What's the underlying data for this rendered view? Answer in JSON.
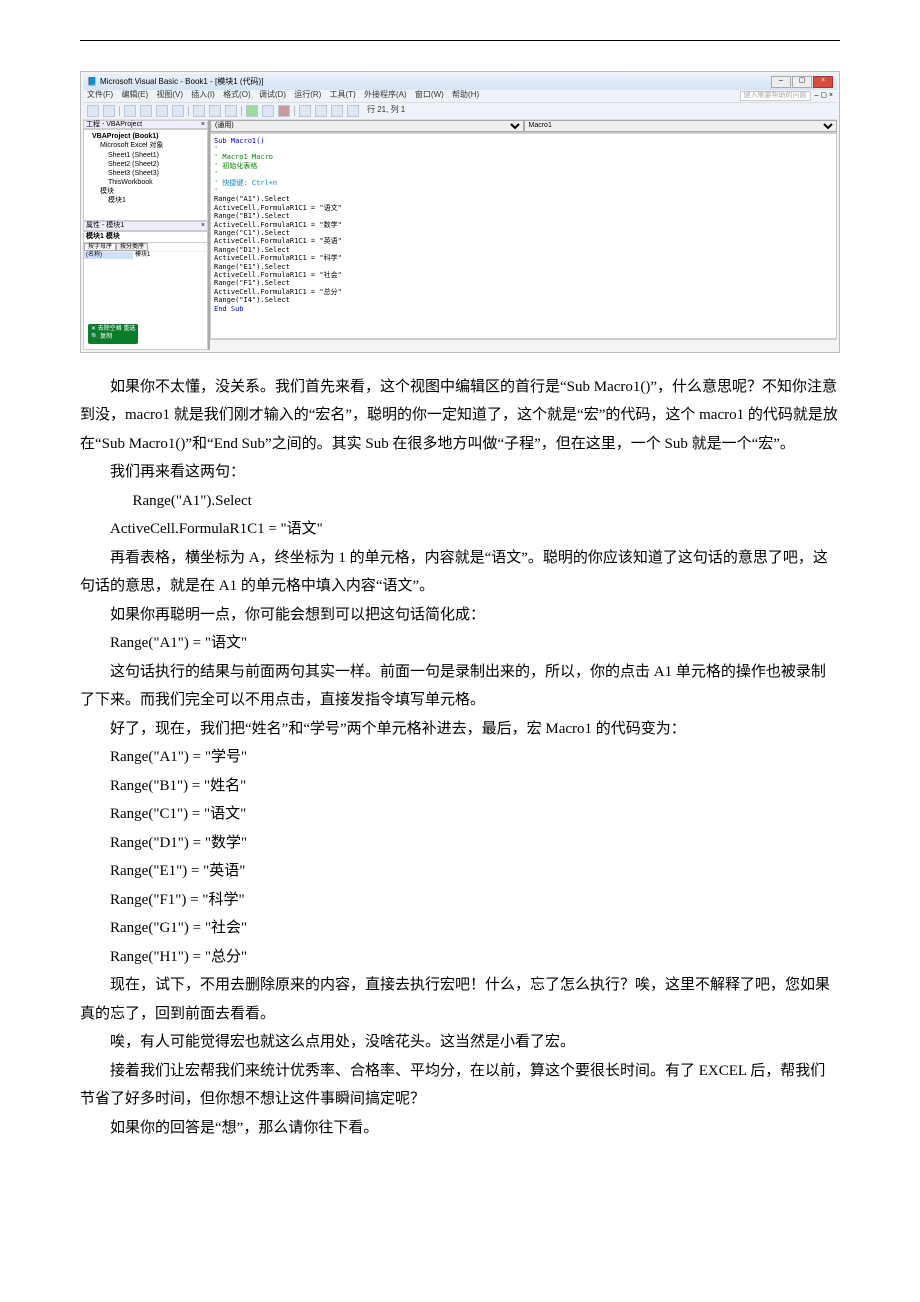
{
  "screenshot": {
    "title": "Microsoft Visual Basic - Book1 - [模块1 (代码)]",
    "helpPlaceholder": "键入需要帮助的问题",
    "menu": [
      "文件(F)",
      "编辑(E)",
      "视图(V)",
      "插入(I)",
      "格式(O)",
      "调试(D)",
      "运行(R)",
      "工具(T)",
      "外接程序(A)",
      "窗口(W)",
      "帮助(H)"
    ],
    "toolbarStatus": "行 21, 列 1",
    "projectPaneTitle": "工程 - VBAProject",
    "tree": {
      "root": "VBAProject (Book1)",
      "folder1": "Microsoft Excel 对象",
      "sheets": [
        "Sheet1 (Sheet1)",
        "Sheet2 (Sheet2)",
        "Sheet3 (Sheet3)",
        "ThisWorkbook"
      ],
      "folder2": "模块",
      "module": "模块1"
    },
    "propPaneTitle": "属性 - 模块1",
    "propSelect": "模块1 模块",
    "tabs": [
      "按字母序",
      "按分类序"
    ],
    "propRow": {
      "k": "(名称)",
      "v": "模块1"
    },
    "tooltip1": "去除空格 重选",
    "tooltip2": "复制",
    "dropdown1": "(通用)",
    "dropdown2": "Macro1",
    "code": {
      "l1": "Sub Macro1()",
      "l2": "'",
      "l3": "' Macro1 Macro",
      "l4": "' 初始化表格",
      "l5": "'",
      "l6": "' 快捷键: Ctrl+n",
      "l7": "'",
      "c1a": "    Range(\"A1\").Select",
      "c1b": "    ActiveCell.FormulaR1C1 = \"语文\"",
      "c2a": "    Range(\"B1\").Select",
      "c2b": "    ActiveCell.FormulaR1C1 = \"数学\"",
      "c3a": "    Range(\"C1\").Select",
      "c3b": "    ActiveCell.FormulaR1C1 = \"英语\"",
      "c4a": "    Range(\"D1\").Select",
      "c4b": "    ActiveCell.FormulaR1C1 = \"科学\"",
      "c5a": "    Range(\"E1\").Select",
      "c5b": "    ActiveCell.FormulaR1C1 = \"社会\"",
      "c6a": "    Range(\"F1\").Select",
      "c6b": "    ActiveCell.FormulaR1C1 = \"总分\"",
      "c7": "    Range(\"I4\").Select",
      "end": "End Sub"
    }
  },
  "body": {
    "p1": "如果你不太懂，没关系。我们首先来看，这个视图中编辑区的首行是“Sub Macro1()”，什么意思呢？不知你注意到没，macro1 就是我们刚才输入的“宏名”，聪明的你一定知道了，这个就是“宏”的代码，这个 macro1 的代码就是放在“Sub Macro1()”和“End Sub”之间的。其实 Sub 在很多地方叫做“子程”，但在这里，一个 Sub 就是一个“宏”。",
    "p2": "我们再来看这两句：",
    "c1": "Range(\"A1\").Select",
    "c2": "ActiveCell.FormulaR1C1 = \"语文\"",
    "p3": "再看表格，横坐标为 A，终坐标为 1 的单元格，内容就是“语文”。聪明的你应该知道了这句话的意思了吧，这句话的意思，就是在 A1 的单元格中填入内容“语文”。",
    "p4": "如果你再聪明一点，你可能会想到可以把这句话简化成：",
    "c3": "Range(\"A1\") = \"语文\"",
    "p5": "这句话执行的结果与前面两句其实一样。前面一句是录制出来的，所以，你的点击 A1 单元格的操作也被录制了下来。而我们完全可以不用点击，直接发指令填写单元格。",
    "p6": "好了，现在，我们把“姓名”和“学号”两个单元格补进去，最后，宏 Macro1 的代码变为：",
    "r1": "Range(\"A1\") = \"学号\"",
    "r2": "Range(\"B1\") = \"姓名\"",
    "r3": "Range(\"C1\") = \"语文\"",
    "r4": "Range(\"D1\") = \"数学\"",
    "r5": "Range(\"E1\") = \"英语\"",
    "r6": "Range(\"F1\") = \"科学\"",
    "r7": "Range(\"G1\") = \"社会\"",
    "r8": "Range(\"H1\") = \"总分\"",
    "p7": "现在，试下，不用去删除原来的内容，直接去执行宏吧！什么，忘了怎么执行？唉，这里不解释了吧，您如果真的忘了，回到前面去看看。",
    "p8": "唉，有人可能觉得宏也就这么点用处，没啥花头。这当然是小看了宏。",
    "p9": "接着我们让宏帮我们来统计优秀率、合格率、平均分，在以前，算这个要很长时间。有了 EXCEL 后，帮我们节省了好多时间，但你想不想让这件事瞬间搞定呢？",
    "p10": "如果你的回答是“想”，那么请你往下看。"
  }
}
